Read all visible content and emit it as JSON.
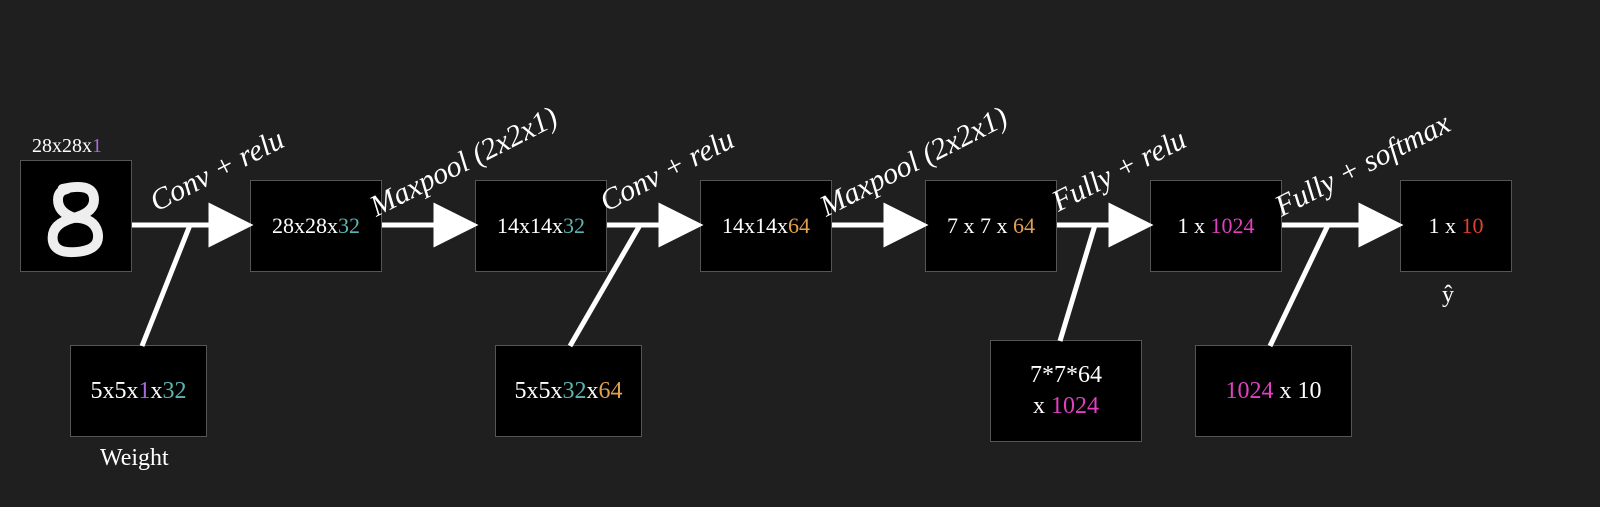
{
  "input": {
    "dim": {
      "a": "28x28x",
      "b": "1"
    },
    "glyph": "8"
  },
  "ops": {
    "conv1": "Conv + relu",
    "pool1": "Maxpool (2x2x1)",
    "conv2": "Conv + relu",
    "pool2": "Maxpool (2x2x1)",
    "fc1": "Fully + relu",
    "fc2": "Fully + softmax"
  },
  "feat": {
    "f1": {
      "a": "28x28x",
      "b": "32"
    },
    "f2": {
      "a": "14x14x",
      "b": "32"
    },
    "f3": {
      "a": "14x14x",
      "b": "64"
    },
    "f4": {
      "a": "7 x 7 x ",
      "b": "64"
    },
    "f5": {
      "a": "1 x ",
      "b": "1024"
    },
    "f6": {
      "a": "1 x ",
      "b": "10"
    }
  },
  "weights": {
    "label": "Weight",
    "w1": {
      "a": "5x5x",
      "b": "1",
      "c": "x",
      "d": "32"
    },
    "w2": {
      "a": "5x5x",
      "b": "32",
      "c": "x",
      "d": "64"
    },
    "w3": {
      "top": "7*7*64",
      "bot_a": "x ",
      "bot_b": "1024"
    },
    "w4": {
      "a": "1024",
      "b": " x 10"
    }
  },
  "output_label": "ŷ"
}
